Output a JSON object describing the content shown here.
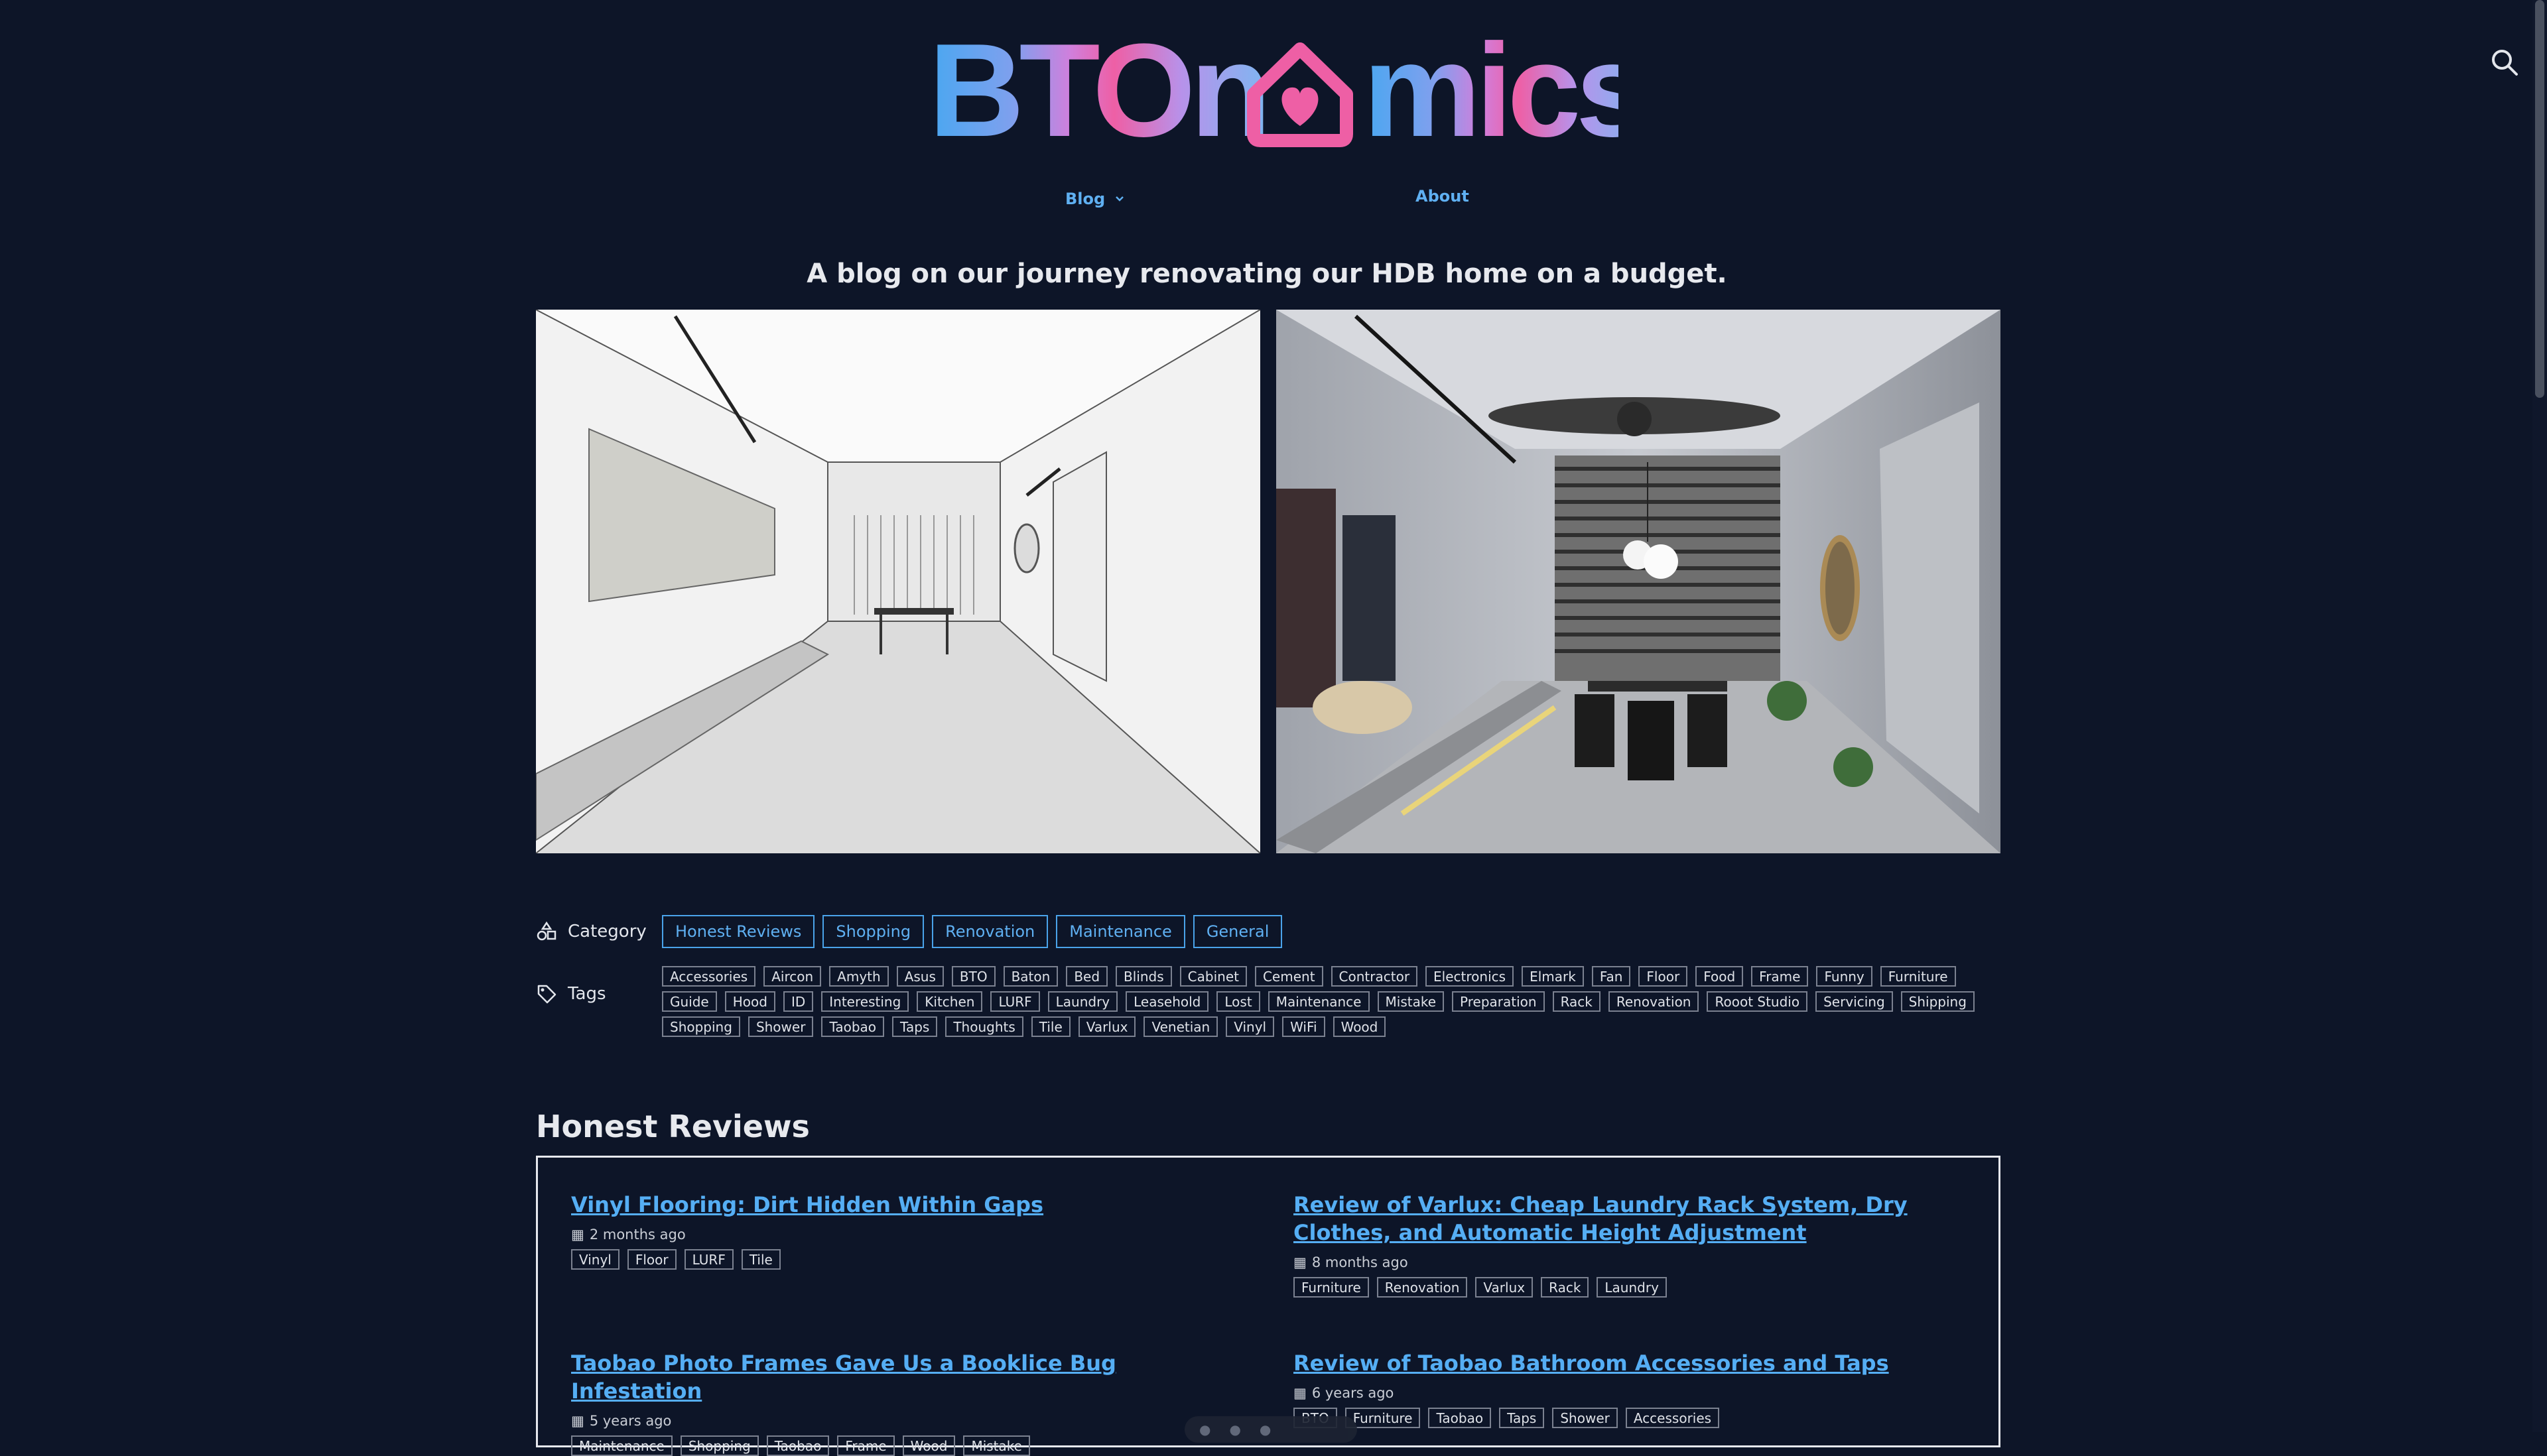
{
  "header": {
    "logo_text": "BTOnomics",
    "nav": {
      "blog": "Blog",
      "about": "About"
    },
    "tagline": "A blog on our journey renovating our HDB home on a budget."
  },
  "hero": {
    "left_image": "sketch-rendering-of-living-room",
    "right_image": "photo-of-renovated-living-room"
  },
  "filters": {
    "category_label": "Category",
    "categories": [
      "Honest Reviews",
      "Shopping",
      "Renovation",
      "Maintenance",
      "General"
    ],
    "tags_label": "Tags",
    "tags": [
      "Accessories",
      "Aircon",
      "Amyth",
      "Asus",
      "BTO",
      "Baton",
      "Bed",
      "Blinds",
      "Cabinet",
      "Cement",
      "Contractor",
      "Electronics",
      "Elmark",
      "Fan",
      "Floor",
      "Food",
      "Frame",
      "Funny",
      "Furniture",
      "Guide",
      "Hood",
      "ID",
      "Interesting",
      "Kitchen",
      "LURF",
      "Laundry",
      "Leasehold",
      "Lost",
      "Maintenance",
      "Mistake",
      "Preparation",
      "Rack",
      "Renovation",
      "Rooot Studio",
      "Servicing",
      "Shipping",
      "Shopping",
      "Shower",
      "Taobao",
      "Taps",
      "Thoughts",
      "Tile",
      "Varlux",
      "Venetian",
      "Vinyl",
      "WiFi",
      "Wood"
    ]
  },
  "section": {
    "title": "Honest Reviews",
    "posts": [
      {
        "title": "Vinyl Flooring: Dirt Hidden Within Gaps",
        "date": "2 months ago",
        "tags": [
          "Vinyl",
          "Floor",
          "LURF",
          "Tile"
        ]
      },
      {
        "title": "Review of Varlux: Cheap Laundry Rack System, Dry Clothes, and Automatic Height Adjustment",
        "date": "8 months ago",
        "tags": [
          "Furniture",
          "Renovation",
          "Varlux",
          "Rack",
          "Laundry"
        ]
      },
      {
        "title": "Taobao Photo Frames Gave Us a Booklice Bug Infestation",
        "date": "5 years ago",
        "tags": [
          "Maintenance",
          "Shopping",
          "Taobao",
          "Frame",
          "Wood",
          "Mistake"
        ]
      },
      {
        "title": "Review of Taobao Bathroom Accessories and Taps",
        "date": "6 years ago",
        "tags": [
          "BTO",
          "Furniture",
          "Taobao",
          "Taps",
          "Shower",
          "Accessories"
        ]
      }
    ]
  },
  "colors": {
    "background": "#0d1528",
    "link": "#55aef4",
    "logo_gradient": [
      "#4fa9f0",
      "#c286e6",
      "#ec5fa6",
      "#8fb4f0"
    ]
  }
}
